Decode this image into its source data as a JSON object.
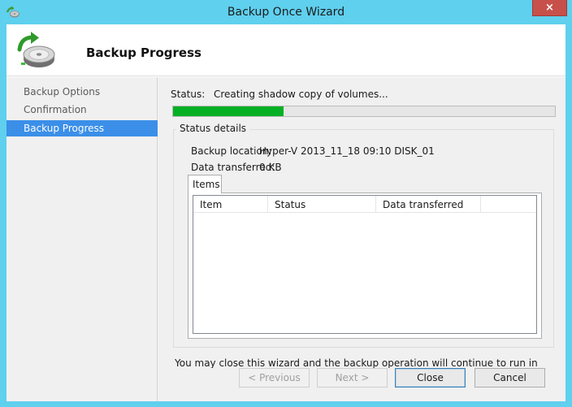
{
  "window": {
    "title": "Backup Once Wizard",
    "close_glyph": "×",
    "icon": "backup-wizard-icon"
  },
  "header": {
    "title": "Backup Progress",
    "icon": "backup-disk-icon"
  },
  "nav": {
    "items": [
      {
        "label": "Backup Options",
        "selected": false
      },
      {
        "label": "Confirmation",
        "selected": false
      },
      {
        "label": "Backup Progress",
        "selected": true
      }
    ]
  },
  "status": {
    "label": "Status:",
    "value": "Creating shadow copy of volumes...",
    "progress_percent": 29,
    "progress_color": "#06b025"
  },
  "status_details": {
    "title": "Status details",
    "backup_location_label": "Backup location:",
    "backup_location_value": "Hyper-V 2013_11_18 09:10 DISK_01",
    "data_transferred_label": "Data transferred:",
    "data_transferred_value": "0 KB"
  },
  "items_tab": {
    "label": "Items",
    "columns": [
      "Item",
      "Status",
      "Data transferred"
    ],
    "rows": []
  },
  "note": "You may close this wizard and the backup operation will continue to run in the background.",
  "buttons": {
    "previous": "< Previous",
    "next": "Next >",
    "close": "Close",
    "cancel": "Cancel"
  },
  "colors": {
    "titlebar": "#5fd0ee",
    "nav_selected": "#3b8fe8",
    "close_button": "#c7504b"
  }
}
